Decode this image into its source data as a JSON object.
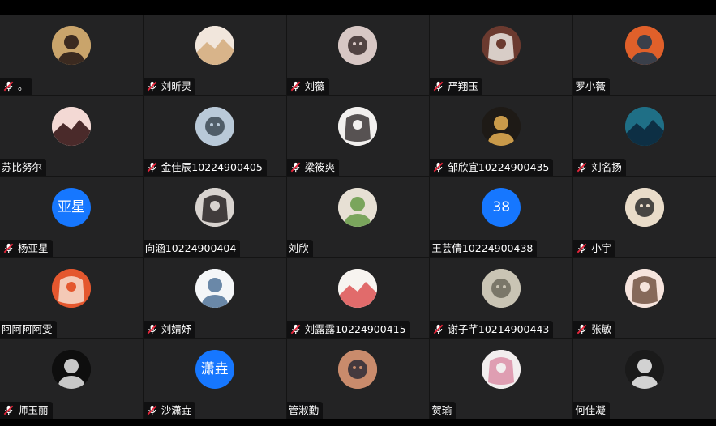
{
  "participants": [
    {
      "name": "。",
      "muted": true,
      "avatar": {
        "type": "photo",
        "icon": "cartoon-girl-avatar-icon",
        "bg": "#c9a46b",
        "fg": "#3b2a20"
      }
    },
    {
      "name": "刘昕灵",
      "muted": true,
      "avatar": {
        "type": "photo",
        "icon": "blonde-girl-avatar-icon",
        "bg": "#f1e6dc",
        "fg": "#d8b48a"
      }
    },
    {
      "name": "刘薇",
      "muted": true,
      "avatar": {
        "type": "photo",
        "icon": "girl-photo-avatar-icon",
        "bg": "#d7c7c4",
        "fg": "#3a2b2b"
      }
    },
    {
      "name": "严翔玉",
      "muted": true,
      "avatar": {
        "type": "photo",
        "icon": "white-dog-avatar-icon",
        "bg": "#6b3a2f",
        "fg": "#f4f2ee"
      }
    },
    {
      "name": "罗小薇",
      "muted": false,
      "avatar": {
        "type": "photo",
        "icon": "orange-character-avatar-icon",
        "bg": "#e0602a",
        "fg": "#3a3f4a"
      }
    },
    {
      "name": "苏比努尔",
      "muted": false,
      "avatar": {
        "type": "photo",
        "icon": "anime-girl-avatar-icon",
        "bg": "#f3d9d4",
        "fg": "#4a2a2a"
      }
    },
    {
      "name": "金佳辰10224900405",
      "muted": true,
      "avatar": {
        "type": "photo",
        "icon": "landscape-avatar-icon",
        "bg": "#b9c9d8",
        "fg": "#3d4a55"
      }
    },
    {
      "name": "梁筱爽",
      "muted": true,
      "avatar": {
        "type": "photo",
        "icon": "girl-sketch-avatar-icon",
        "bg": "#f2f0ee",
        "fg": "#2f2a2a"
      }
    },
    {
      "name": "邹欣宜10224900435",
      "muted": true,
      "avatar": {
        "type": "photo",
        "icon": "dark-light-avatar-icon",
        "bg": "#1e1a16",
        "fg": "#c99a4a"
      }
    },
    {
      "name": "刘名扬",
      "muted": true,
      "avatar": {
        "type": "photo",
        "icon": "mountain-avatar-icon",
        "bg": "#1f6f86",
        "fg": "#0d2f44"
      }
    },
    {
      "name": "杨亚星",
      "muted": true,
      "avatar": {
        "type": "text",
        "text": "亚星",
        "bg": "#1677ff"
      }
    },
    {
      "name": "向涵10224900404",
      "muted": false,
      "avatar": {
        "type": "photo",
        "icon": "girl-portrait-avatar-icon",
        "bg": "#d8d3cf",
        "fg": "#1b1716"
      }
    },
    {
      "name": "刘欣",
      "muted": false,
      "avatar": {
        "type": "photo",
        "icon": "green-cartoon-avatar-icon",
        "bg": "#e7e0d4",
        "fg": "#7aa55c"
      }
    },
    {
      "name": "王芸倩10224900438",
      "muted": false,
      "avatar": {
        "type": "text",
        "text": "38",
        "bg": "#1677ff"
      }
    },
    {
      "name": "小宇",
      "muted": true,
      "avatar": {
        "type": "photo",
        "icon": "penguin-avatar-icon",
        "bg": "#e9dcc9",
        "fg": "#2b2b2b"
      }
    },
    {
      "name": "阿阿阿阿雯",
      "muted": false,
      "avatar": {
        "type": "photo",
        "icon": "time-luck-text-avatar-icon",
        "bg": "#e4572e",
        "fg": "#f7e6d8"
      }
    },
    {
      "name": "刘婧妤",
      "muted": true,
      "avatar": {
        "type": "photo",
        "icon": "handwriting-avatar-icon",
        "bg": "#f4f6f8",
        "fg": "#6a88a8"
      }
    },
    {
      "name": "刘露露10224900415",
      "muted": true,
      "avatar": {
        "type": "photo",
        "icon": "flower-avatar-icon",
        "bg": "#f7f4f0",
        "fg": "#e16b6b"
      }
    },
    {
      "name": "谢子芊10214900443",
      "muted": true,
      "avatar": {
        "type": "photo",
        "icon": "room-photo-avatar-icon",
        "bg": "#c9c4b4",
        "fg": "#6c6a5c"
      }
    },
    {
      "name": "张敏",
      "muted": true,
      "avatar": {
        "type": "photo",
        "icon": "cartoon-face-avatar-icon",
        "bg": "#f6e4dd",
        "fg": "#6a4a3a"
      }
    },
    {
      "name": "师玉丽",
      "muted": true,
      "avatar": {
        "type": "photo",
        "icon": "dark-portrait-avatar-icon",
        "bg": "#0e0e0e",
        "fg": "#c8c8c8"
      }
    },
    {
      "name": "沙潇垚",
      "muted": true,
      "avatar": {
        "type": "text",
        "text": "潇垚",
        "bg": "#1677ff"
      }
    },
    {
      "name": "管淑勤",
      "muted": false,
      "avatar": {
        "type": "photo",
        "icon": "anime-character-avatar-icon",
        "bg": "#c98b6c",
        "fg": "#2d2a36"
      }
    },
    {
      "name": "贺瑜",
      "muted": false,
      "avatar": {
        "type": "photo",
        "icon": "blossom-avatar-icon",
        "bg": "#f2eeee",
        "fg": "#d98aa2"
      }
    },
    {
      "name": "何佳凝",
      "muted": false,
      "avatar": {
        "type": "photo",
        "icon": "piano-bw-avatar-icon",
        "bg": "#1a1a1a",
        "fg": "#d2d2d2"
      }
    }
  ],
  "colors": {
    "background": "#000000",
    "tile": "#232324",
    "accent_blue": "#1677ff",
    "muted_red": "#e6253a"
  }
}
